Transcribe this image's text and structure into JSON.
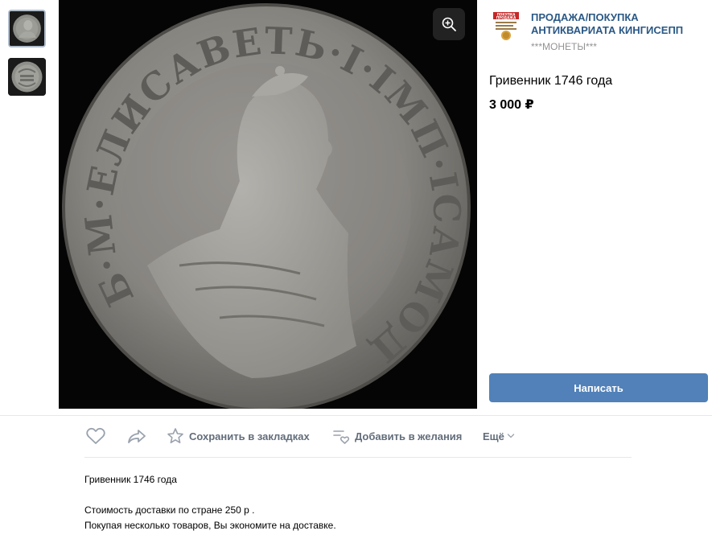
{
  "gallery": {
    "thumbnails": [
      {
        "name": "coin-obverse"
      },
      {
        "name": "coin-reverse"
      }
    ],
    "main_image": {
      "name": "coin-obverse",
      "inscription": "Б·М·ЕЛИСАВЕТЬ·I·IМП·IСАМОД·ВСЕРОС"
    },
    "zoom_icon": "zoom-in-icon"
  },
  "seller": {
    "logo_text_1": "ПОКУПКА",
    "logo_text_2": "ПРОДАЖА",
    "name": "ПРОДАЖА/ПОКУПКА АНТИКВАРИАТА КИНГИСЕПП",
    "category": "***МОНЕТЫ***"
  },
  "product": {
    "title": "Гривенник 1746 года",
    "price": "3 000 ₽",
    "write_button": "Написать"
  },
  "actions": {
    "like_icon": "heart-icon",
    "share_icon": "share-icon",
    "save_label": "Сохранить в закладках",
    "wishlist_label": "Добавить в желания",
    "more_label": "Ещё"
  },
  "description": {
    "line1": "Гривенник 1746 года",
    "line2": "Стоимость доставки по стране 250 р .",
    "line3": "Покупая несколько товаров, Вы экономите на доставке."
  },
  "colors": {
    "accent": "#5181b8",
    "link": "#2a5885",
    "muted": "#939393",
    "action_text": "#626d7a"
  }
}
